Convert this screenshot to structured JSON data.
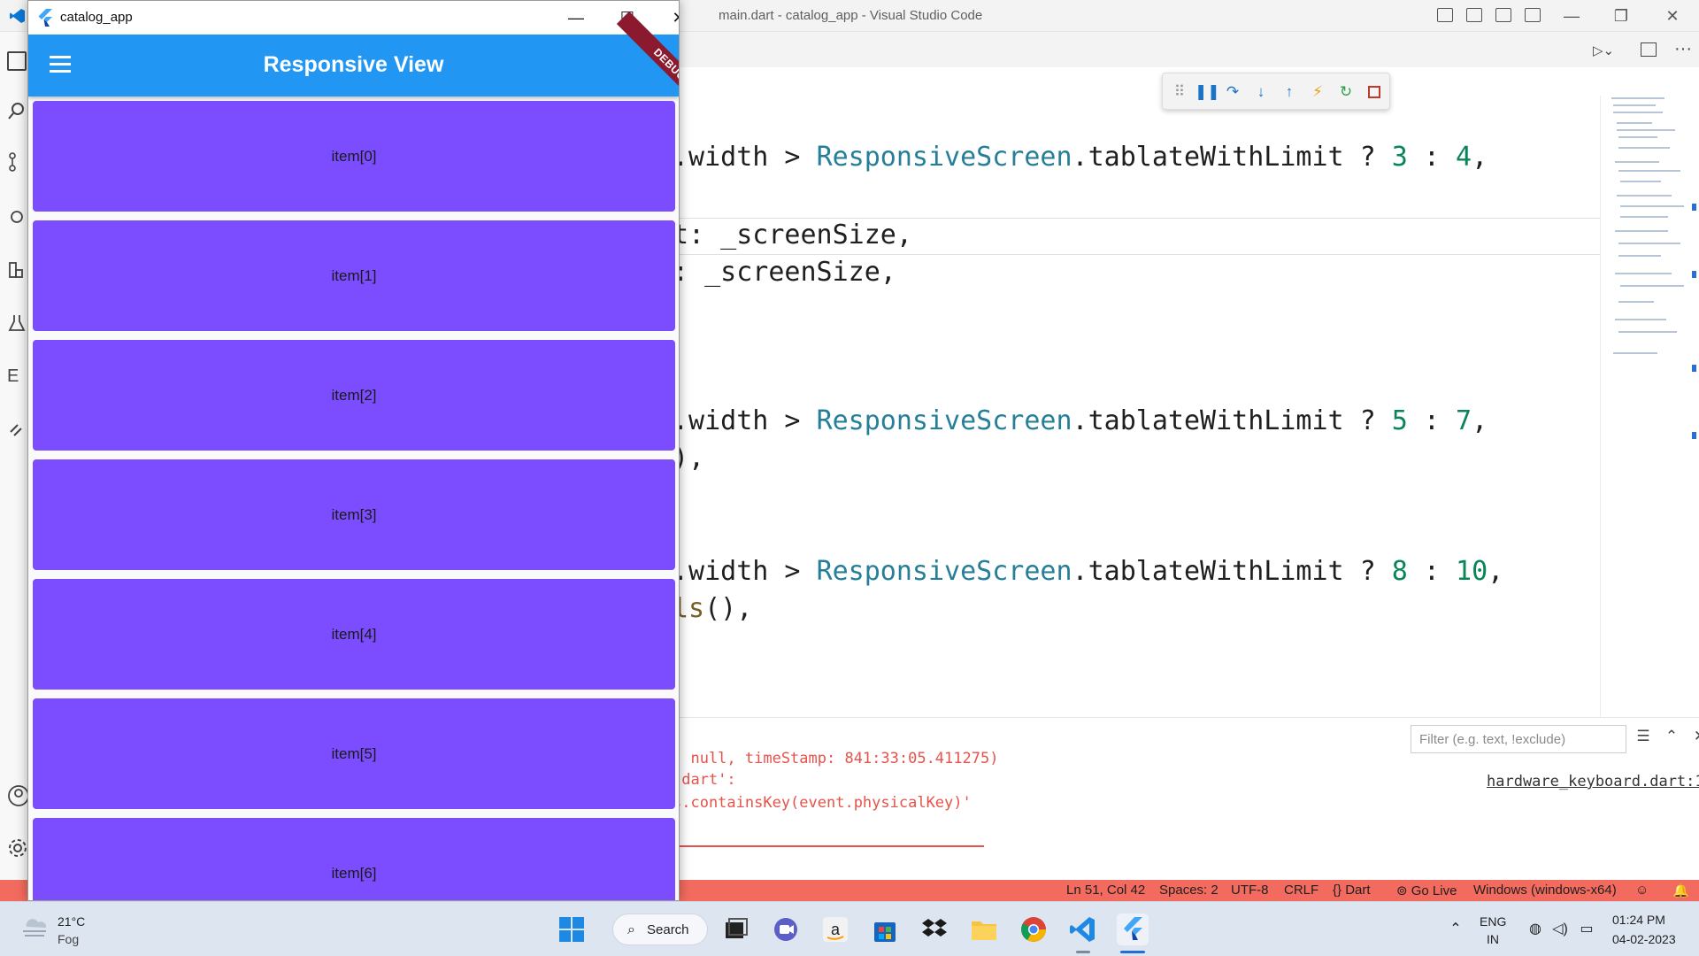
{
  "vscode": {
    "window_title": "main.dart - catalog_app - Visual Studio Code",
    "code_lines": [
      {
        "pre": ".width > ",
        "type": "ResponsiveScreen",
        "mid": ".tablateWithLimit ? ",
        "a": "3",
        "sep": " : ",
        "b": "4",
        "post": ","
      },
      {
        "text": "t: _screenSize,"
      },
      {
        "text": ": _screenSize,"
      },
      {
        "pre": ".width > ",
        "type": "ResponsiveScreen",
        "mid": ".tablateWithLimit ? ",
        "a": "5",
        "sep": " : ",
        "b": "7",
        "post": ","
      },
      {
        "text": "),"
      },
      {
        "pre": ".width > ",
        "type": "ResponsiveScreen",
        "mid": ".tablateWithLimit ? ",
        "a": "8",
        "sep": " : ",
        "b": "10",
        "post": ","
      },
      {
        "fn": "ls",
        "text": "(),"
      }
    ],
    "panel": {
      "filter_placeholder": "Filter (e.g. text, !exclude)",
      "output_lines": [
        "  null, timeStamp: 841:33:05.411275)",
        ".dart':",
        "s.containsKey(event.physicalKey)'"
      ],
      "output_link": "hardware_keyboard.dart:1"
    },
    "statusbar": {
      "position": "Ln 51, Col 42",
      "spaces": "Spaces: 2",
      "encoding": "UTF-8",
      "eol": "CRLF",
      "language": "Dart",
      "go_live": "Go Live",
      "device": "Windows (windows-x64)"
    },
    "colors": {
      "statusbar": "#f36b5f",
      "type_token": "#267f99",
      "number_token": "#098658",
      "error_text": "#e5534b"
    }
  },
  "app": {
    "window_title": "catalog_app",
    "appbar_title": "Responsive View",
    "debug_banner": "DEBUG",
    "items": [
      "item[0]",
      "item[1]",
      "item[2]",
      "item[3]",
      "item[4]",
      "item[5]",
      "item[6]"
    ],
    "colors": {
      "appbar": "#2196f3",
      "item_card": "#7c4dff"
    }
  },
  "taskbar": {
    "weather_temp": "21°C",
    "weather_condition": "Fog",
    "search_label": "Search",
    "language": "ENG",
    "region": "IN",
    "time": "01:24 PM",
    "date": "04-02-2023",
    "pinned_apps": [
      "start-icon",
      "task-view-icon",
      "teams-chat-icon",
      "amazon-icon",
      "microsoft-store-icon",
      "dropbox-icon",
      "file-explorer-icon",
      "chrome-icon",
      "vscode-icon",
      "flutter-icon"
    ]
  }
}
